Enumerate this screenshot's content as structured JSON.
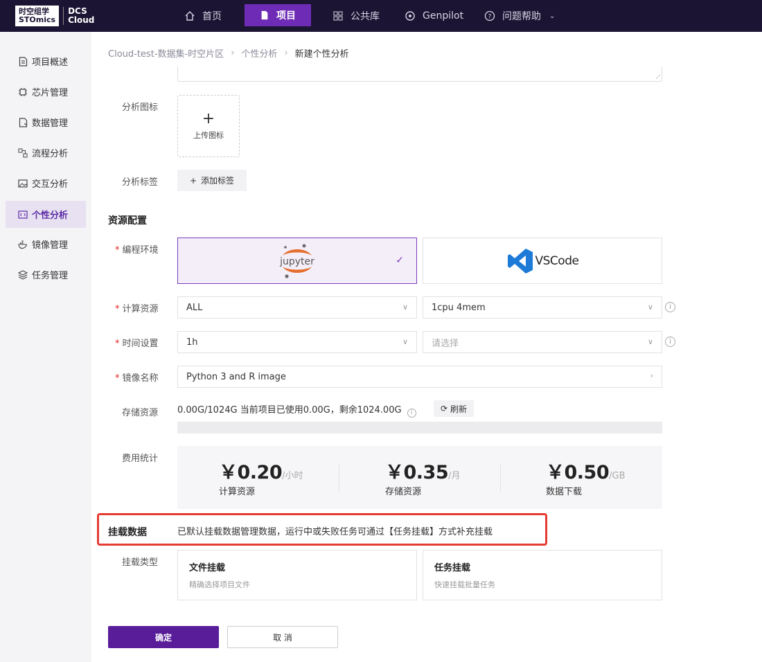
{
  "brand": {
    "cn": "时空组学",
    "en": "STOmics",
    "right_top": "DCS",
    "right_bottom": "Cloud"
  },
  "nav": {
    "home": "首页",
    "project": "项目",
    "library": "公共库",
    "genpilot": "Genpilot",
    "help": "问题帮助"
  },
  "sidebar": {
    "items": [
      {
        "label": "项目概述",
        "icon": "document-icon"
      },
      {
        "label": "芯片管理",
        "icon": "chip-icon"
      },
      {
        "label": "数据管理",
        "icon": "data-file-icon"
      },
      {
        "label": "流程分析",
        "icon": "flow-icon"
      },
      {
        "label": "交互分析",
        "icon": "image-icon"
      },
      {
        "label": "个性分析",
        "icon": "code-icon"
      },
      {
        "label": "镜像管理",
        "icon": "docker-icon"
      },
      {
        "label": "任务管理",
        "icon": "layers-icon"
      }
    ],
    "active_index": 5
  },
  "breadcrumb": {
    "root": "Cloud-test-数据集-时空片区",
    "section": "个性分析",
    "current": "新建个性分析"
  },
  "form": {
    "icon_label": "分析图标",
    "upload_label": "上传图标",
    "tags_label": "分析标签",
    "add_tag": "添加标签",
    "resource_section": "资源配置",
    "env_label": "编程环境",
    "env_options": [
      "jupyter",
      "VSCode"
    ],
    "compute_label": "计算资源",
    "compute_value": "ALL",
    "compute_spec": "1cpu 4mem",
    "time_label": "时间设置",
    "time_value": "1h",
    "time_placeholder": "请选择",
    "image_label": "镜像名称",
    "image_value": "Python 3 and R image",
    "storage_label": "存储资源",
    "storage_text": "0.00G/1024G   当前项目已使用0.00G，剩余1024.00G",
    "refresh": "刷新",
    "fee_label": "费用统计",
    "fees": [
      {
        "price": "￥0.20",
        "unit": "/小时",
        "name": "计算资源"
      },
      {
        "price": "￥0.35",
        "unit": "/月",
        "name": "存储资源"
      },
      {
        "price": "￥0.50",
        "unit": "/GB",
        "name": "数据下载"
      }
    ],
    "mount_section": "挂载数据",
    "mount_desc": "已默认挂载数据管理数据，运行中或失败任务可通过【任务挂载】方式补充挂载",
    "mount_type_label": "挂载类型",
    "mount_options": [
      {
        "title": "文件挂载",
        "desc": "精确选择项目文件"
      },
      {
        "title": "任务挂载",
        "desc": "快速挂载批量任务"
      }
    ],
    "ok": "确定",
    "cancel": "取 消"
  },
  "colors": {
    "brand_purple": "#6e2bb5",
    "topbar": "#1c1433",
    "highlight": "#e53b33"
  }
}
